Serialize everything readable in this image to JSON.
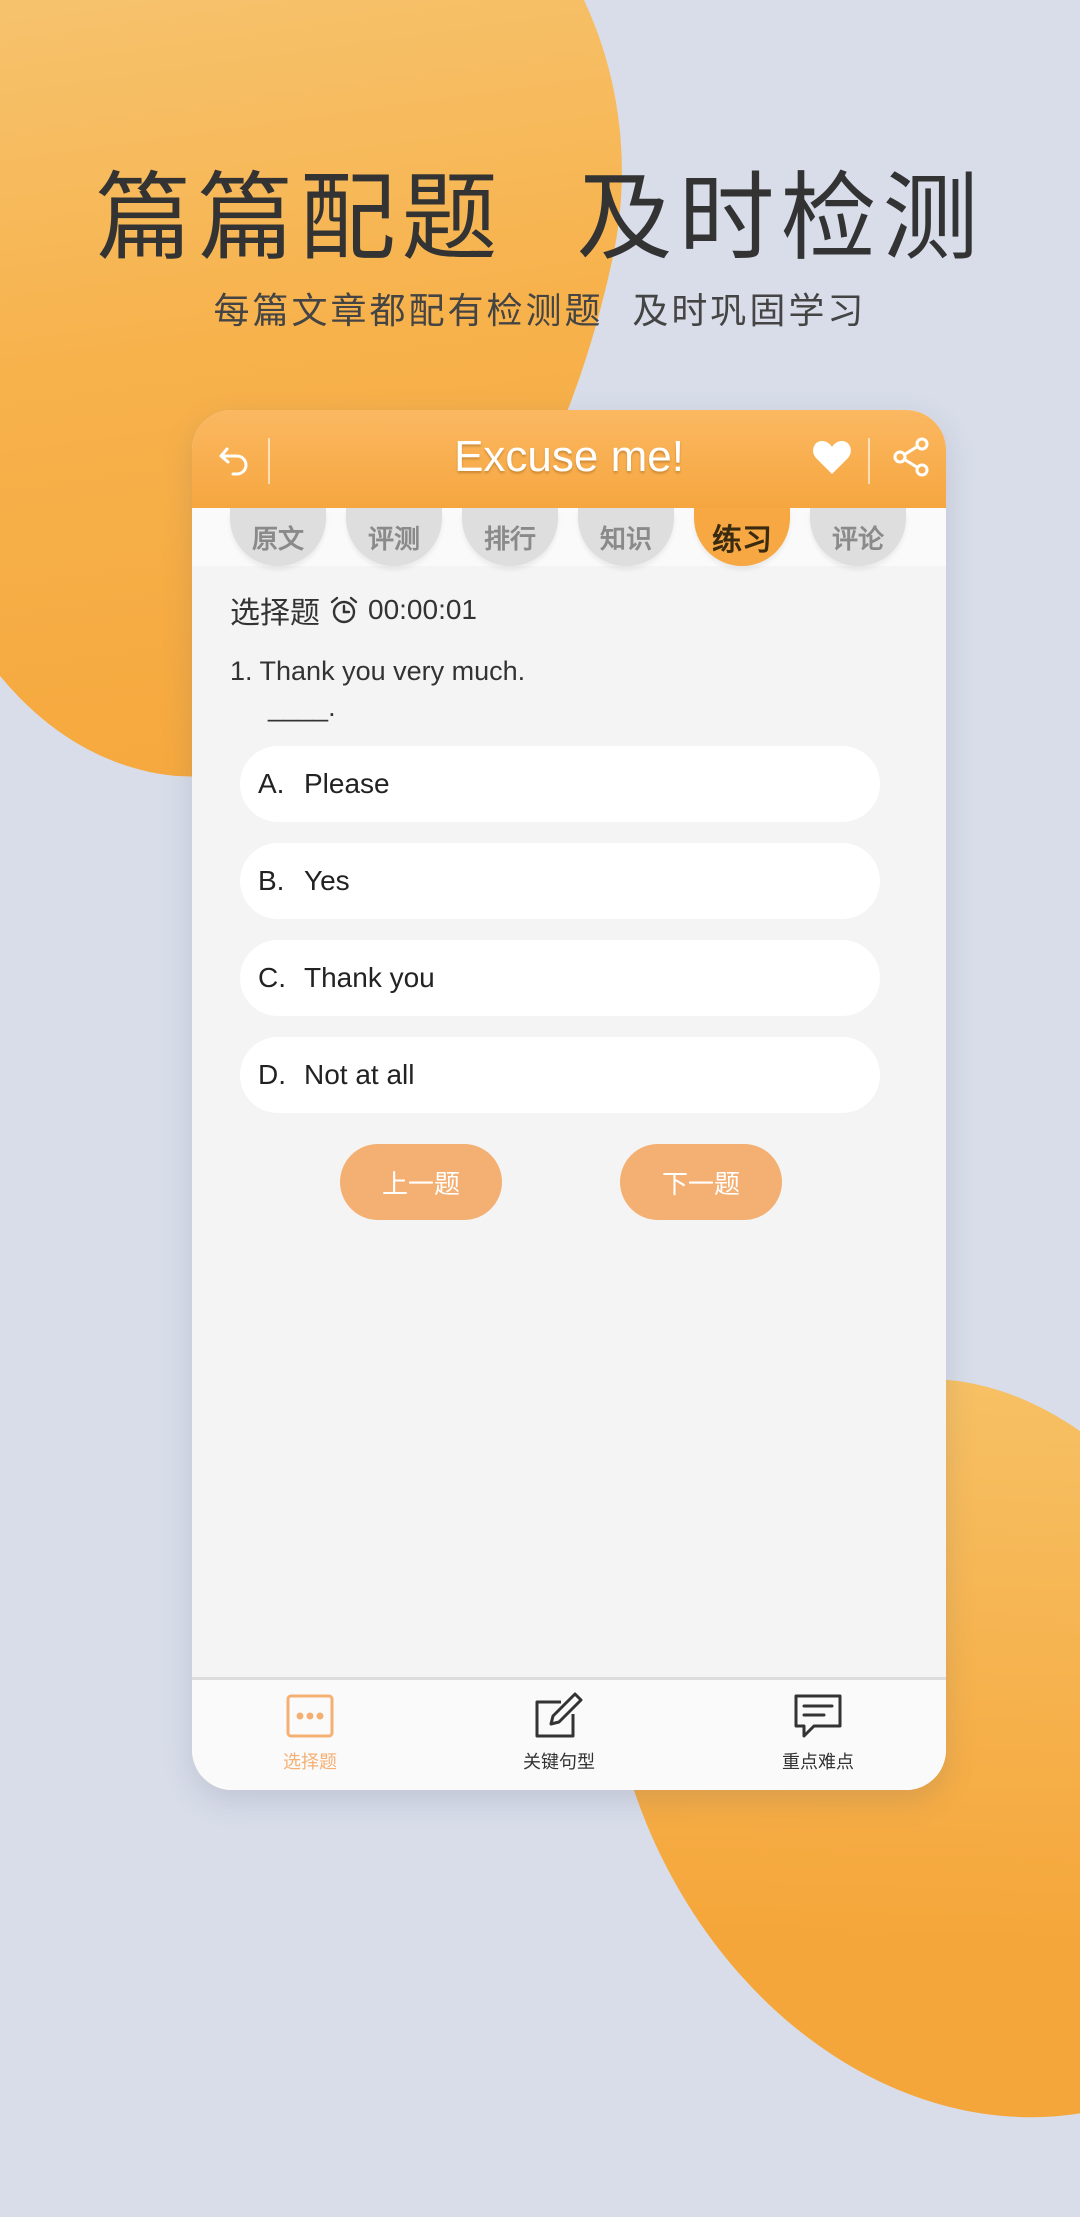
{
  "hero": {
    "title": "篇篇配题  及时检测",
    "subtitle": "每篇文章都配有检测题  及时巩固学习"
  },
  "header": {
    "title": "Excuse me!",
    "icons": [
      "back-icon",
      "heart-icon",
      "share-icon"
    ]
  },
  "tabs": [
    {
      "label": "原文",
      "active": false
    },
    {
      "label": "评测",
      "active": false
    },
    {
      "label": "排行",
      "active": false
    },
    {
      "label": "知识",
      "active": false
    },
    {
      "label": "练习",
      "active": true
    },
    {
      "label": "评论",
      "active": false
    }
  ],
  "quiz": {
    "type_label": "选择题",
    "timer": "00:00:01",
    "question": "1. Thank you very much.",
    "blank": "____.",
    "options": [
      {
        "letter": "A.",
        "text": "Please"
      },
      {
        "letter": "B.",
        "text": "Yes"
      },
      {
        "letter": "C.",
        "text": "Thank you"
      },
      {
        "letter": "D.",
        "text": "Not at all"
      }
    ],
    "prev_label": "上一题",
    "next_label": "下一题"
  },
  "bottom_nav": [
    {
      "label": "选择题",
      "icon": "dots-box-icon",
      "active": true
    },
    {
      "label": "关键句型",
      "icon": "edit-icon",
      "active": false
    },
    {
      "label": "重点难点",
      "icon": "message-icon",
      "active": false
    }
  ],
  "colors": {
    "accent": "#f7a843",
    "button": "#f4b073",
    "background": "#d8dde9"
  }
}
